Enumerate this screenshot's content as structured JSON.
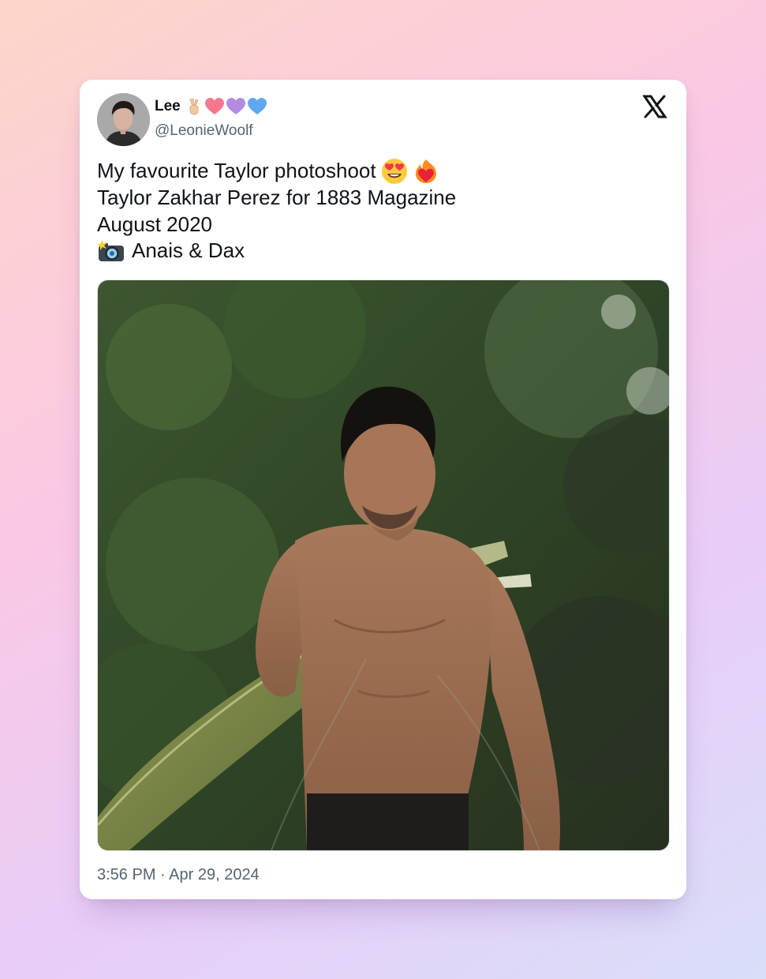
{
  "tweet": {
    "display_name": "Lee",
    "name_emoji": [
      "victory-hand-emoji",
      "pink-heart-emoji",
      "purple-heart-emoji",
      "blue-heart-emoji"
    ],
    "handle": "@LeonieWoolf",
    "lines": [
      "My favourite Taylor photoshoot",
      "Taylor Zakhar Perez for 1883 Magazine",
      "August 2020",
      "Anais & Dax"
    ],
    "line1_emoji": [
      "heart-eyes-emoji",
      "heart-on-fire-emoji"
    ],
    "line4_emoji": "camera-with-flash-emoji",
    "timestamp": "3:56 PM · Apr 29, 2024"
  },
  "icons": {
    "platform_logo": "x-logo-icon",
    "avatar": "avatar"
  },
  "colors": {
    "text_primary": "#0f1419",
    "text_secondary": "#536471",
    "card_background": "#ffffff",
    "pink_heart": "#f5788f",
    "purple_heart": "#b28be3",
    "blue_heart": "#5fa8ef"
  }
}
